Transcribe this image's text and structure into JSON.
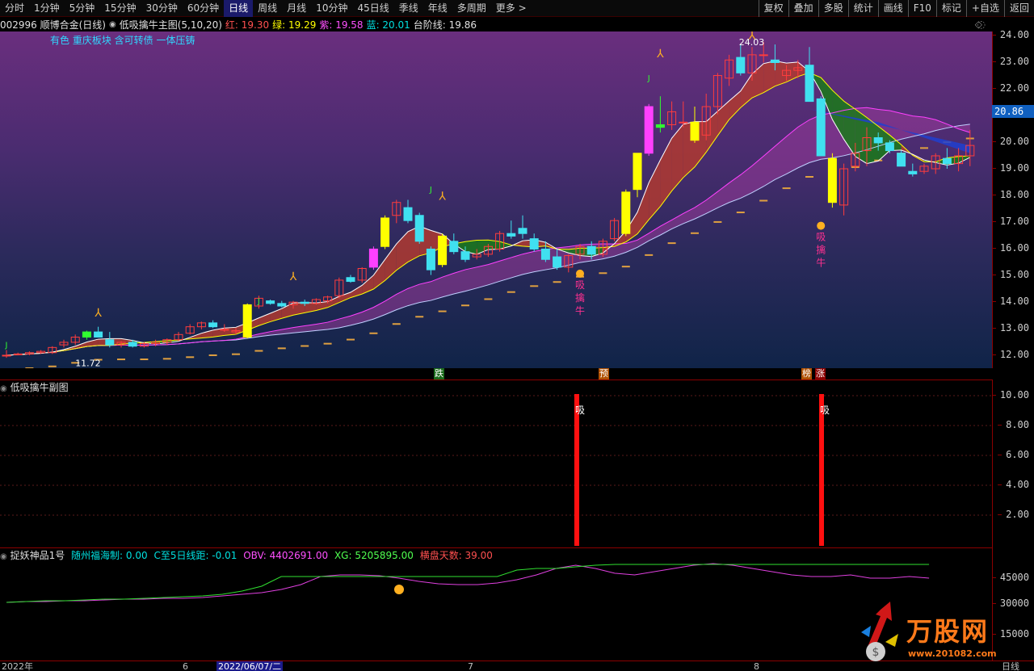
{
  "toolbar": {
    "periods": [
      "分时",
      "1分钟",
      "5分钟",
      "15分钟",
      "30分钟",
      "60分钟",
      "日线",
      "周线",
      "月线",
      "10分钟",
      "45日线",
      "季线",
      "年线",
      "多周期",
      "更多 >"
    ],
    "active_period": "日线",
    "right_buttons": [
      "复权",
      "叠加",
      "多股",
      "统计",
      "画线",
      "F10",
      "标记",
      "+自选",
      "返回"
    ]
  },
  "info": {
    "stock": "002996 顺博合金(日线)",
    "indicator": "低吸擒牛主图(5,10,20)",
    "red_label": "红: 19.30",
    "green_label": "绿: 19.29",
    "purple_label": "紫: 19.58",
    "blue_label": "蓝: 20.01",
    "step_label": "台阶线: 19.86"
  },
  "sector_tags": "有色 重庆板块 含可转债 一体压铸",
  "main": {
    "price_axis": [
      "24.00",
      "23.00",
      "22.00",
      "21.00",
      "20.00",
      "19.00",
      "18.00",
      "17.00",
      "16.00",
      "15.00",
      "14.00",
      "13.00",
      "12.00"
    ],
    "current_price": "20.86",
    "high_label": "24.03",
    "low_label": "11.72",
    "signal_chars": [
      "吸",
      "擒",
      "牛"
    ],
    "j_mark": "J"
  },
  "signals": [
    {
      "label": "跌",
      "color": "#1a6a1a"
    },
    {
      "label": "预",
      "color": "#b05000"
    },
    {
      "label": "榜",
      "color": "#b05000"
    },
    {
      "label": "涨",
      "color": "#8b0000"
    }
  ],
  "sub_pane": {
    "title": "低吸擒牛副图",
    "axis": [
      "10.00",
      "8.00",
      "6.00",
      "4.00",
      "2.00"
    ],
    "bar_label": "吸"
  },
  "ind_pane": {
    "title": "捉妖神品1号",
    "item1": "随州福海制: 0.00",
    "item2": "C至5日线距: -0.01",
    "item3": "OBV: 4402691.00",
    "item4": "XG: 5205895.00",
    "item5": "横盘天数: 39.00",
    "axis": [
      "45000",
      "30000",
      "15000"
    ]
  },
  "dates": {
    "d1": "2022年",
    "d2": "6",
    "d3": "2022/06/07/二",
    "d4": "7",
    "d5": "8",
    "d6": "日线"
  },
  "watermark": {
    "title": "万股网",
    "url": "www.201082.com"
  },
  "colors": {
    "up": "#ff3c3c",
    "down": "#40e0f0",
    "yellow": "#ffff00",
    "magenta": "#ff40ff",
    "green": "#30ff30",
    "ma5": "#ffffff",
    "ma10": "#ffff00",
    "ma20": "#ff40ff"
  },
  "chart_data": {
    "type": "candlestick",
    "ylim": [
      11.4,
      24.4
    ],
    "candles": [
      [
        11.9,
        12.1,
        11.8,
        11.9
      ],
      [
        11.95,
        12.0,
        11.9,
        11.95
      ],
      [
        11.95,
        12.05,
        11.9,
        12.0
      ],
      [
        12.0,
        12.1,
        11.95,
        12.05
      ],
      [
        12.0,
        12.25,
        11.95,
        12.2
      ],
      [
        12.3,
        12.5,
        12.2,
        12.4
      ],
      [
        12.4,
        12.7,
        12.3,
        12.6
      ],
      [
        12.6,
        12.85,
        12.5,
        12.8
      ],
      [
        12.8,
        13.0,
        12.6,
        12.6
      ],
      [
        12.5,
        12.8,
        12.2,
        12.3
      ],
      [
        12.3,
        12.45,
        12.2,
        12.4
      ],
      [
        12.4,
        12.5,
        12.2,
        12.25
      ],
      [
        12.25,
        12.4,
        12.2,
        12.35
      ],
      [
        12.35,
        12.5,
        12.25,
        12.4
      ],
      [
        12.4,
        12.55,
        12.3,
        12.5
      ],
      [
        12.5,
        12.8,
        12.45,
        12.7
      ],
      [
        12.75,
        13.1,
        12.7,
        13.0
      ],
      [
        13.0,
        13.2,
        12.9,
        13.15
      ],
      [
        13.15,
        13.25,
        12.95,
        13.0
      ],
      [
        12.9,
        13.1,
        12.8,
        12.9
      ],
      [
        12.8,
        12.95,
        12.7,
        12.85
      ],
      [
        12.6,
        13.9,
        12.55,
        13.85
      ],
      [
        13.8,
        14.2,
        13.7,
        14.1
      ],
      [
        14.0,
        14.05,
        13.85,
        13.9
      ],
      [
        13.9,
        14.0,
        13.75,
        13.8
      ],
      [
        13.85,
        14.0,
        13.7,
        13.95
      ],
      [
        13.95,
        14.05,
        13.8,
        13.9
      ],
      [
        13.9,
        14.1,
        13.85,
        14.05
      ],
      [
        14.0,
        14.2,
        13.9,
        14.15
      ],
      [
        14.2,
        14.9,
        14.1,
        14.8
      ],
      [
        14.9,
        15.0,
        14.7,
        14.75
      ],
      [
        14.8,
        15.3,
        14.7,
        15.25
      ],
      [
        15.3,
        16.1,
        15.2,
        16.0
      ],
      [
        16.1,
        17.3,
        16.0,
        17.2
      ],
      [
        17.3,
        17.9,
        17.0,
        17.8
      ],
      [
        17.6,
        17.9,
        17.0,
        17.1
      ],
      [
        17.3,
        17.4,
        16.2,
        16.3
      ],
      [
        16.0,
        16.1,
        15.0,
        15.2
      ],
      [
        15.4,
        16.6,
        15.3,
        16.5
      ],
      [
        16.3,
        16.6,
        15.8,
        15.9
      ],
      [
        15.9,
        16.1,
        15.5,
        15.6
      ],
      [
        15.7,
        16.0,
        15.6,
        15.8
      ],
      [
        15.8,
        16.2,
        15.7,
        16.1
      ],
      [
        16.0,
        16.7,
        15.9,
        16.6
      ],
      [
        16.6,
        17.1,
        16.4,
        16.5
      ],
      [
        16.8,
        17.3,
        16.4,
        16.6
      ],
      [
        16.4,
        16.6,
        15.9,
        16.0
      ],
      [
        16.0,
        16.3,
        15.5,
        15.6
      ],
      [
        15.7,
        16.0,
        15.2,
        15.3
      ],
      [
        15.3,
        15.8,
        15.1,
        15.75
      ],
      [
        15.8,
        16.2,
        15.6,
        16.1
      ],
      [
        16.1,
        16.3,
        15.6,
        15.8
      ],
      [
        15.8,
        16.4,
        15.7,
        16.3
      ],
      [
        16.4,
        17.2,
        16.3,
        17.1
      ],
      [
        16.6,
        18.3,
        16.5,
        18.2
      ],
      [
        18.3,
        19.7,
        18.0,
        19.7
      ],
      [
        19.7,
        21.6,
        19.6,
        21.5
      ],
      [
        20.8,
        21.9,
        20.5,
        20.7
      ],
      [
        20.8,
        21.7,
        20.6,
        21.3
      ],
      [
        20.9,
        21.7,
        20.7,
        20.9
      ],
      [
        20.9,
        21.5,
        20.1,
        20.2
      ],
      [
        20.4,
        22.0,
        20.2,
        21.5
      ],
      [
        21.5,
        22.8,
        21.2,
        22.7
      ],
      [
        22.6,
        23.5,
        22.3,
        23.3
      ],
      [
        23.4,
        23.9,
        22.7,
        22.8
      ],
      [
        22.8,
        23.8,
        22.5,
        23.5
      ],
      [
        23.5,
        24.0,
        23.2,
        23.5
      ],
      [
        23.3,
        23.9,
        22.9,
        23.2
      ],
      [
        22.7,
        23.1,
        22.5,
        22.9
      ],
      [
        22.9,
        23.3,
        22.6,
        23.0
      ],
      [
        23.1,
        23.8,
        22.2,
        21.7
      ],
      [
        21.8,
        21.9,
        19.7,
        19.6
      ],
      [
        19.5,
        19.7,
        17.6,
        17.8
      ],
      [
        17.7,
        19.3,
        17.3,
        19.1
      ],
      [
        19.2,
        20.1,
        19.0,
        19.7
      ],
      [
        19.8,
        20.7,
        19.2,
        20.3
      ],
      [
        20.3,
        20.5,
        19.8,
        20.1
      ],
      [
        20.1,
        20.2,
        19.7,
        19.8
      ],
      [
        19.7,
        19.8,
        19.3,
        19.2
      ],
      [
        19.0,
        19.3,
        18.8,
        18.9
      ],
      [
        19.0,
        19.3,
        18.9,
        19.2
      ],
      [
        19.1,
        19.7,
        18.9,
        19.6
      ],
      [
        19.5,
        19.9,
        19.1,
        19.3
      ],
      [
        19.3,
        19.9,
        19.0,
        19.6
      ],
      [
        19.6,
        20.6,
        19.2,
        20.0
      ]
    ]
  }
}
